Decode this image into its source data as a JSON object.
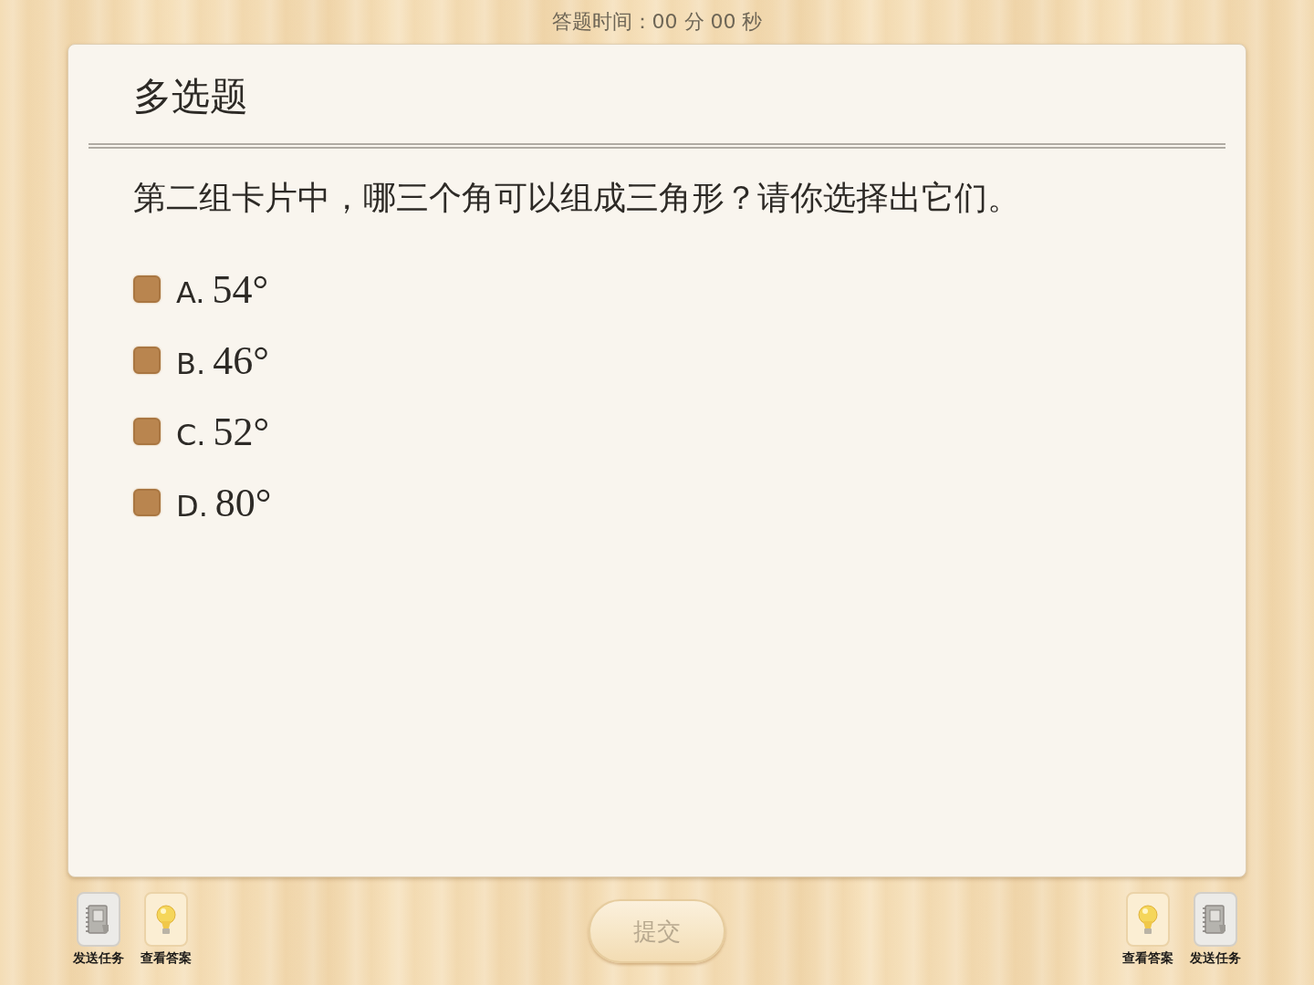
{
  "timer": "答题时间：00 分 00 秒",
  "question": {
    "type_title": "多选题",
    "text": "第二组卡片中，哪三个角可以组成三角形？请你选择出它们。",
    "options": [
      {
        "letter": "A.",
        "value": "54°",
        "checked": false
      },
      {
        "letter": "B.",
        "value": "46°",
        "checked": false
      },
      {
        "letter": "C.",
        "value": "52°",
        "checked": false
      },
      {
        "letter": "D.",
        "value": "80°",
        "checked": false
      }
    ]
  },
  "toolbar": {
    "left": [
      {
        "kind": "send",
        "label": "发送任务"
      },
      {
        "kind": "answer",
        "label": "查看答案"
      }
    ],
    "submit": {
      "label": "提交",
      "disabled": true
    },
    "right": [
      {
        "kind": "answer",
        "label": "查看答案"
      },
      {
        "kind": "send",
        "label": "发送任务"
      }
    ]
  }
}
